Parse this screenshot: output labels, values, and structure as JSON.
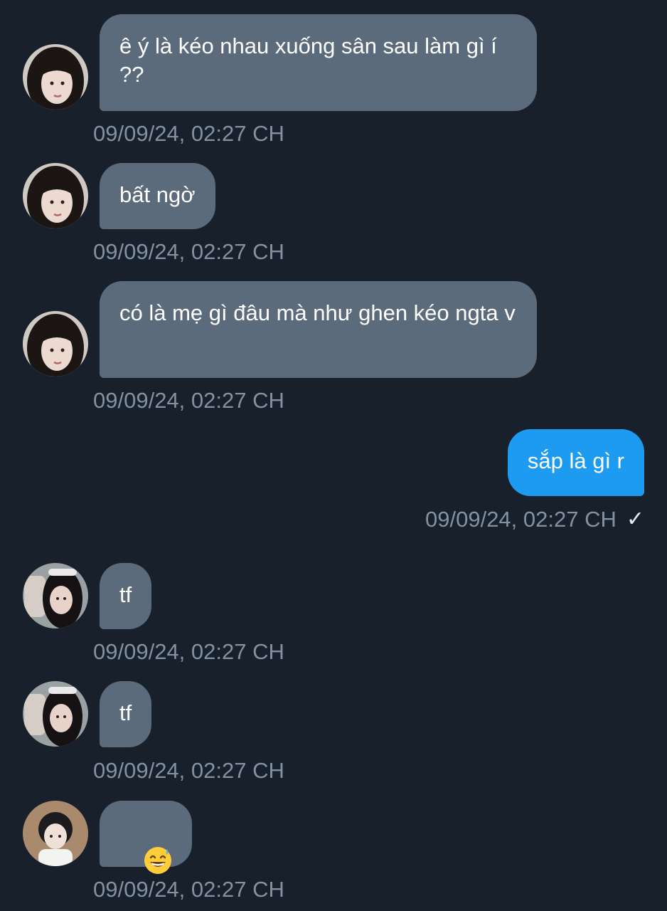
{
  "colors": {
    "background": "#17202b",
    "incoming_bubble": "#5c6b7b",
    "outgoing_bubble": "#1d9bf0",
    "timestamp": "#8292a2"
  },
  "messages": [
    {
      "direction": "incoming",
      "avatar": "avatar-girl-1",
      "text": "ê ý là kéo nhau xuống sân sau làm gì í ??",
      "timestamp": "09/09/24, 02:27 CH"
    },
    {
      "direction": "incoming",
      "avatar": "avatar-girl-1",
      "text": "bất ngờ",
      "timestamp": "09/09/24, 02:27 CH"
    },
    {
      "direction": "incoming",
      "avatar": "avatar-girl-1",
      "text": "có là mẹ gì đâu mà như ghen kéo ngta v",
      "timestamp": "09/09/24, 02:27 CH"
    },
    {
      "direction": "outgoing",
      "text": "sắp là gì r",
      "timestamp": "09/09/24, 02:27 CH",
      "status_icon": "checkmark-icon",
      "status_glyph": "✓"
    },
    {
      "direction": "incoming",
      "avatar": "avatar-girl-2",
      "text": "tf",
      "timestamp": "09/09/24, 02:27 CH"
    },
    {
      "direction": "incoming",
      "avatar": "avatar-girl-2",
      "text": "tf",
      "timestamp": "09/09/24, 02:27 CH"
    },
    {
      "direction": "incoming",
      "avatar": "avatar-boy",
      "text": "",
      "emoji": "grinning-sweat-emoji",
      "timestamp": "09/09/24, 02:27 CH"
    }
  ]
}
